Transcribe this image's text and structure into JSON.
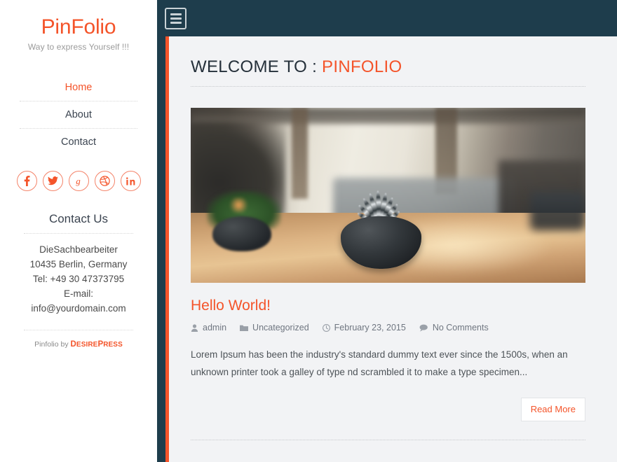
{
  "sidebar": {
    "site_title": "PinFolio",
    "tagline": "Way to express Yourself !!!",
    "nav": [
      {
        "label": "Home",
        "active": true
      },
      {
        "label": "About",
        "active": false
      },
      {
        "label": "Contact",
        "active": false
      }
    ],
    "socials": [
      {
        "name": "facebook",
        "label": "Facebook"
      },
      {
        "name": "twitter",
        "label": "Twitter"
      },
      {
        "name": "google-plus",
        "label": "Google Plus"
      },
      {
        "name": "dribbble",
        "label": "Dribbble"
      },
      {
        "name": "linkedin",
        "label": "LinkedIn"
      }
    ],
    "contact": {
      "heading": "Contact Us",
      "name": "DieSachbearbeiter",
      "address": "10435 Berlin, Germany",
      "phone": "Tel: +49 30 47373795",
      "email_label": "E-mail:",
      "email": "info@yourdomain.com"
    },
    "credit": {
      "prefix": "Pinfolio by ",
      "brand_first": "D",
      "brand_rest1": "ESIRE",
      "brand_second": "P",
      "brand_rest2": "RESS"
    }
  },
  "topbar": {
    "menu_icon": "hamburger-icon",
    "menu_label": "Toggle navigation"
  },
  "main": {
    "welcome_prefix": "WELCOME TO : ",
    "welcome_brand": "PINFOLIO",
    "featured_image_alt": "Blurred interior with zebra haworthia succulent in a dark round pot on a wooden table",
    "post": {
      "title": "Hello World!",
      "meta": {
        "author_icon": "user-icon",
        "author": "admin",
        "category_icon": "folder-icon",
        "category": "Uncategorized",
        "date_icon": "clock-icon",
        "date": "February 23, 2015",
        "comments_icon": "comment-icon",
        "comments": "No Comments"
      },
      "excerpt": "Lorem Ipsum has been the industry's standard dummy text ever since the 1500s, when an unknown printer took a galley of type nd scrambled it to make a type specimen...",
      "read_more": "Read More"
    }
  },
  "colors": {
    "accent": "#f4542a",
    "dark": "#1e3d4c",
    "content_bg": "#f2f3f5",
    "text": "#3b4450"
  }
}
